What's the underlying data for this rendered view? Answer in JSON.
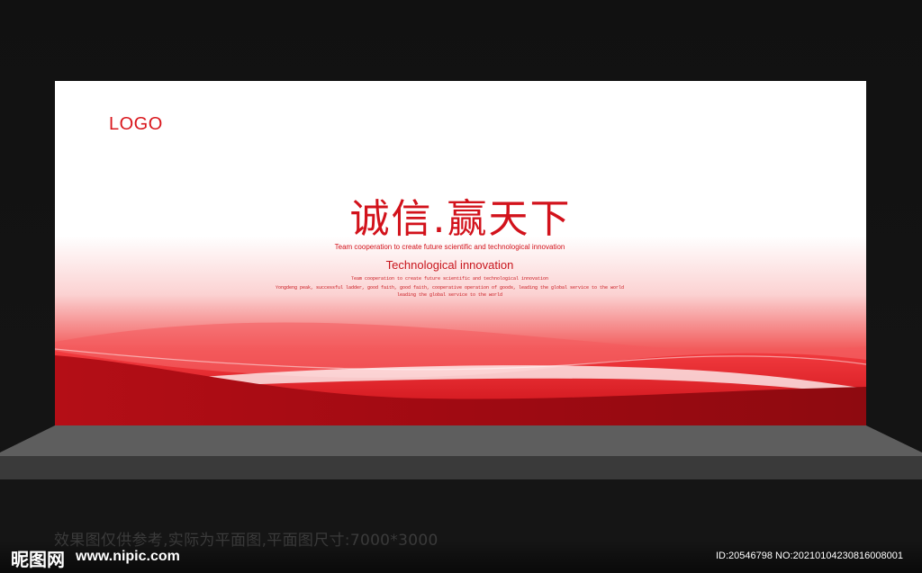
{
  "logo": "LOGO",
  "title": "诚信.赢天下",
  "subtitle_small": "Team cooperation to create future scientific and technological innovation",
  "subtitle_main": "Technological innovation",
  "lines": [
    "Team cooperation to create future scientific and technological innovation",
    "Yongdeng peak, successful ladder, good faith, good faith, cooperative operation of goods, leading the global service to the world",
    "leading the global service to the world"
  ],
  "caption": "效果图仅供参考,实际为平面图,平面图尺寸:7000*3000",
  "watermark": {
    "brand": "昵图网",
    "url": "www.nipic.com",
    "id": "ID:20546798 NO:20210104230816008001"
  },
  "colors": {
    "brand_red": "#d2121b",
    "dark_red": "#a80a12",
    "stage_bg": "#111111"
  }
}
